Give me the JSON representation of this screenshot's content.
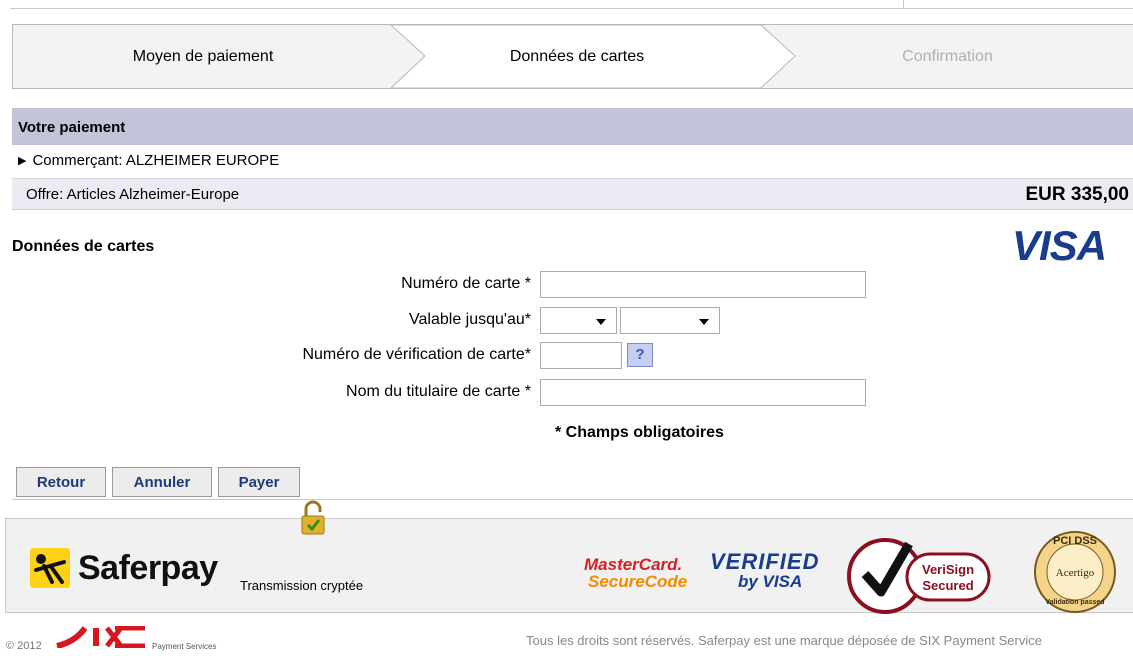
{
  "steps": [
    {
      "label": "Moyen de paiement"
    },
    {
      "label": "Données de cartes"
    },
    {
      "label": "Confirmation"
    }
  ],
  "payment": {
    "header": "Votre paiement",
    "merchant": "Commerçant: ALZHEIMER EUROPE",
    "offer": "Offre: Articles Alzheimer-Europe",
    "amount": "EUR 335,00"
  },
  "card": {
    "title": "Données de cartes",
    "brand": "VISA",
    "labels": {
      "number": "Numéro de carte *",
      "valid": "Valable jusqu'au*",
      "cvc": "Numéro de vérification de carte*",
      "holder": "Nom du titulaire de carte *"
    },
    "values": {
      "number": "",
      "month": "",
      "year": "",
      "cvc": "",
      "holder": ""
    },
    "help": "?",
    "required_note": "* Champs obligatoires"
  },
  "buttons": {
    "back": "Retour",
    "cancel": "Annuler",
    "pay": "Payer"
  },
  "footer": {
    "brand": "Saferpay",
    "encryption": "Transmission cryptée",
    "mastercard_line1": "MasterCard.",
    "mastercard_line2": "SecureCode",
    "vbv_line1": "VERIFIED",
    "vbv_line2": "by VISA",
    "verisign_line1": "VeriSign",
    "verisign_line2": "Secured",
    "pci_top": "PCI DSS",
    "pci_mid": "Acertigo",
    "pci_bottom": "Validation passed",
    "copyright": "© 2012",
    "six_sub": "Payment Services",
    "rights": "Tous les droits sont réservés. Saferpay est une marque déposée de SIX Payment Service"
  },
  "colors": {
    "header_bg": "#c3c3d9",
    "offer_bg": "#ebebf3",
    "button_text": "#1f3a7a",
    "visa_blue": "#1a3c8c",
    "saferpay_yellow": "#ffd21a",
    "six_red": "#d6171f"
  }
}
